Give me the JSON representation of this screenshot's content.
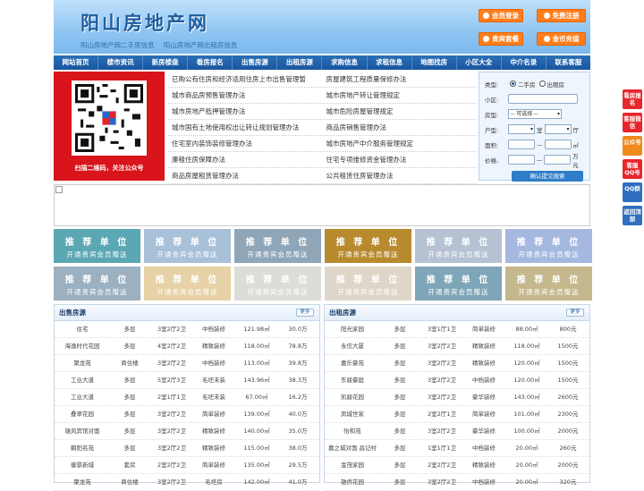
{
  "header": {
    "logo": "阳山房地产网",
    "sub1": "阳山房地产网二手房信息",
    "sub2": "阳山房地产网出租房信息",
    "buttons": [
      "会员登录",
      "免费注册",
      "贵宾套餐",
      "金币充值"
    ]
  },
  "nav": [
    "网站首页",
    "楼市资讯",
    "新房楼盘",
    "看房报名",
    "出售房源",
    "出租房源",
    "求购信息",
    "求租信息",
    "地图找房",
    "小区大全",
    "中介名录",
    "联系客服"
  ],
  "qr": {
    "caption": "扫描二维码，关注公众号"
  },
  "policies": [
    [
      "已购公有住房和经济适用住房上市出售管理暂",
      "房屋建筑工程质量保修办法"
    ],
    [
      "城市商品房预售管理办法",
      "城市房地产转让管理规定"
    ],
    [
      "城市房地产抵押管理办法",
      "城市危险房屋管理规定"
    ],
    [
      "城市国有土地使用权出让转让规划管理办法",
      "商品房销售管理办法"
    ],
    [
      "住宅室内装饰装修管理办法",
      "城市房地产中介服务管理规定"
    ],
    [
      "廉租住房保障办法",
      "住宅专项维修资金管理办法"
    ],
    [
      "商品房屋租赁管理办法",
      "公共租赁住房管理办法"
    ]
  ],
  "search": {
    "type_label": "类型:",
    "opt_sale": "二手房",
    "opt_rent": "出租房",
    "community_label": "小区:",
    "house_type_label": "房型:",
    "house_type_value": "-- 可选择 --",
    "layout_label": "户型:",
    "room_unit": "室",
    "hall_unit": "厅",
    "area_label": "面积:",
    "area_unit": "㎡",
    "price_label": "价格:",
    "price_unit": "万元",
    "submit": "确认提交搜索"
  },
  "ads": {
    "title": "推 荐 单 位",
    "subtitle": "开通贵宾会员赠送",
    "colors": [
      "#5ba7b3",
      "#a8c0d8",
      "#8fa6b8",
      "#b88a2e",
      "#b6c2d2",
      "#a4b8e0",
      "#9bb0c0",
      "#e6d2a6",
      "#dcdcd8",
      "#ded6c8",
      "#7fa6b8",
      "#c4b88c"
    ]
  },
  "sale": {
    "title": "出售房源",
    "more": "更多",
    "rows": [
      [
        "住宅",
        "多层",
        "3室2厅2卫",
        "中档装修",
        "121.98㎡",
        "30.0万"
      ],
      [
        "海逸时代花园",
        "多层",
        "4室2厅2卫",
        "精致装修",
        "118.00㎡",
        "78.8万"
      ],
      [
        "聚龙苑",
        "商住楼",
        "3室2厅2卫",
        "中档装修",
        "113.00㎡",
        "39.8万"
      ],
      [
        "工业大道",
        "多层",
        "5室2厅3卫",
        "毛坯未装",
        "143.96㎡",
        "38.3万"
      ],
      [
        "工业大道",
        "多层",
        "2室1厅1卫",
        "毛坯未装",
        "67.00㎡",
        "16.2万"
      ],
      [
        "叠翠花园",
        "多层",
        "3室2厅2卫",
        "简单装修",
        "139.00㎡",
        "40.0万"
      ],
      [
        "雄风宾馆对面",
        "多层",
        "3室2厅2卫",
        "精致装修",
        "140.00㎡",
        "35.0万"
      ],
      [
        "朝阳名苑",
        "多层",
        "3室2厅2卫",
        "精致装修",
        "115.00㎡",
        "38.0万"
      ],
      [
        "御景新城",
        "套房",
        "2室2厅2卫",
        "简单装修",
        "135.00㎡",
        "29.5万"
      ],
      [
        "聚龙苑",
        "商住楼",
        "3室2厅2卫",
        "毛坯房",
        "142.00㎡",
        "41.0万"
      ]
    ]
  },
  "rent": {
    "title": "出租房源",
    "more": "更多",
    "rows": [
      [
        "阳光家园",
        "多层",
        "3室1厅1卫",
        "简单装修",
        "88.00㎡",
        "800元"
      ],
      [
        "永信大厦",
        "多层",
        "3室2厅2卫",
        "精致装修",
        "118.00㎡",
        "1500元"
      ],
      [
        "嘉乐豪苑",
        "多层",
        "3室2厅2卫",
        "精致装修",
        "120.00㎡",
        "1500元"
      ],
      [
        "东骏豪庭",
        "多层",
        "3室2厅2卫",
        "中档装修",
        "120.00㎡",
        "1500元"
      ],
      [
        "凯骏花园",
        "多层",
        "3室2厅2卫",
        "豪华装修",
        "143.00㎡",
        "2600元"
      ],
      [
        "凤城世家",
        "多层",
        "2室2厅1卫",
        "简单装修",
        "101.00㎡",
        "2300元"
      ],
      [
        "怡和苑",
        "多层",
        "3室2厅2卫",
        "豪华装修",
        "100.00㎡",
        "2000元"
      ],
      [
        "嘉之城对面 昌记村",
        "多层",
        "1室1厅1卫",
        "中档装修",
        "20.00㎡",
        "260元"
      ],
      [
        "金茂家园",
        "多层",
        "2室2厅2卫",
        "精致装修",
        "20.00㎡",
        "2000元"
      ],
      [
        "雄侨花园",
        "多层",
        "3室2厅2卫",
        "中档装修",
        "20.00㎡",
        "320元"
      ]
    ]
  },
  "side": [
    {
      "label": "看房报名",
      "color": "#e8262c"
    },
    {
      "label": "客服微信",
      "color": "#e8262c"
    },
    {
      "label": "公众号",
      "color": "#f08a1c"
    },
    {
      "label": "客服QQ号",
      "color": "#e8262c"
    },
    {
      "label": "QQ群",
      "color": "#2f6fc0"
    },
    {
      "label": "返回顶部",
      "color": "#2f6fc0"
    }
  ]
}
